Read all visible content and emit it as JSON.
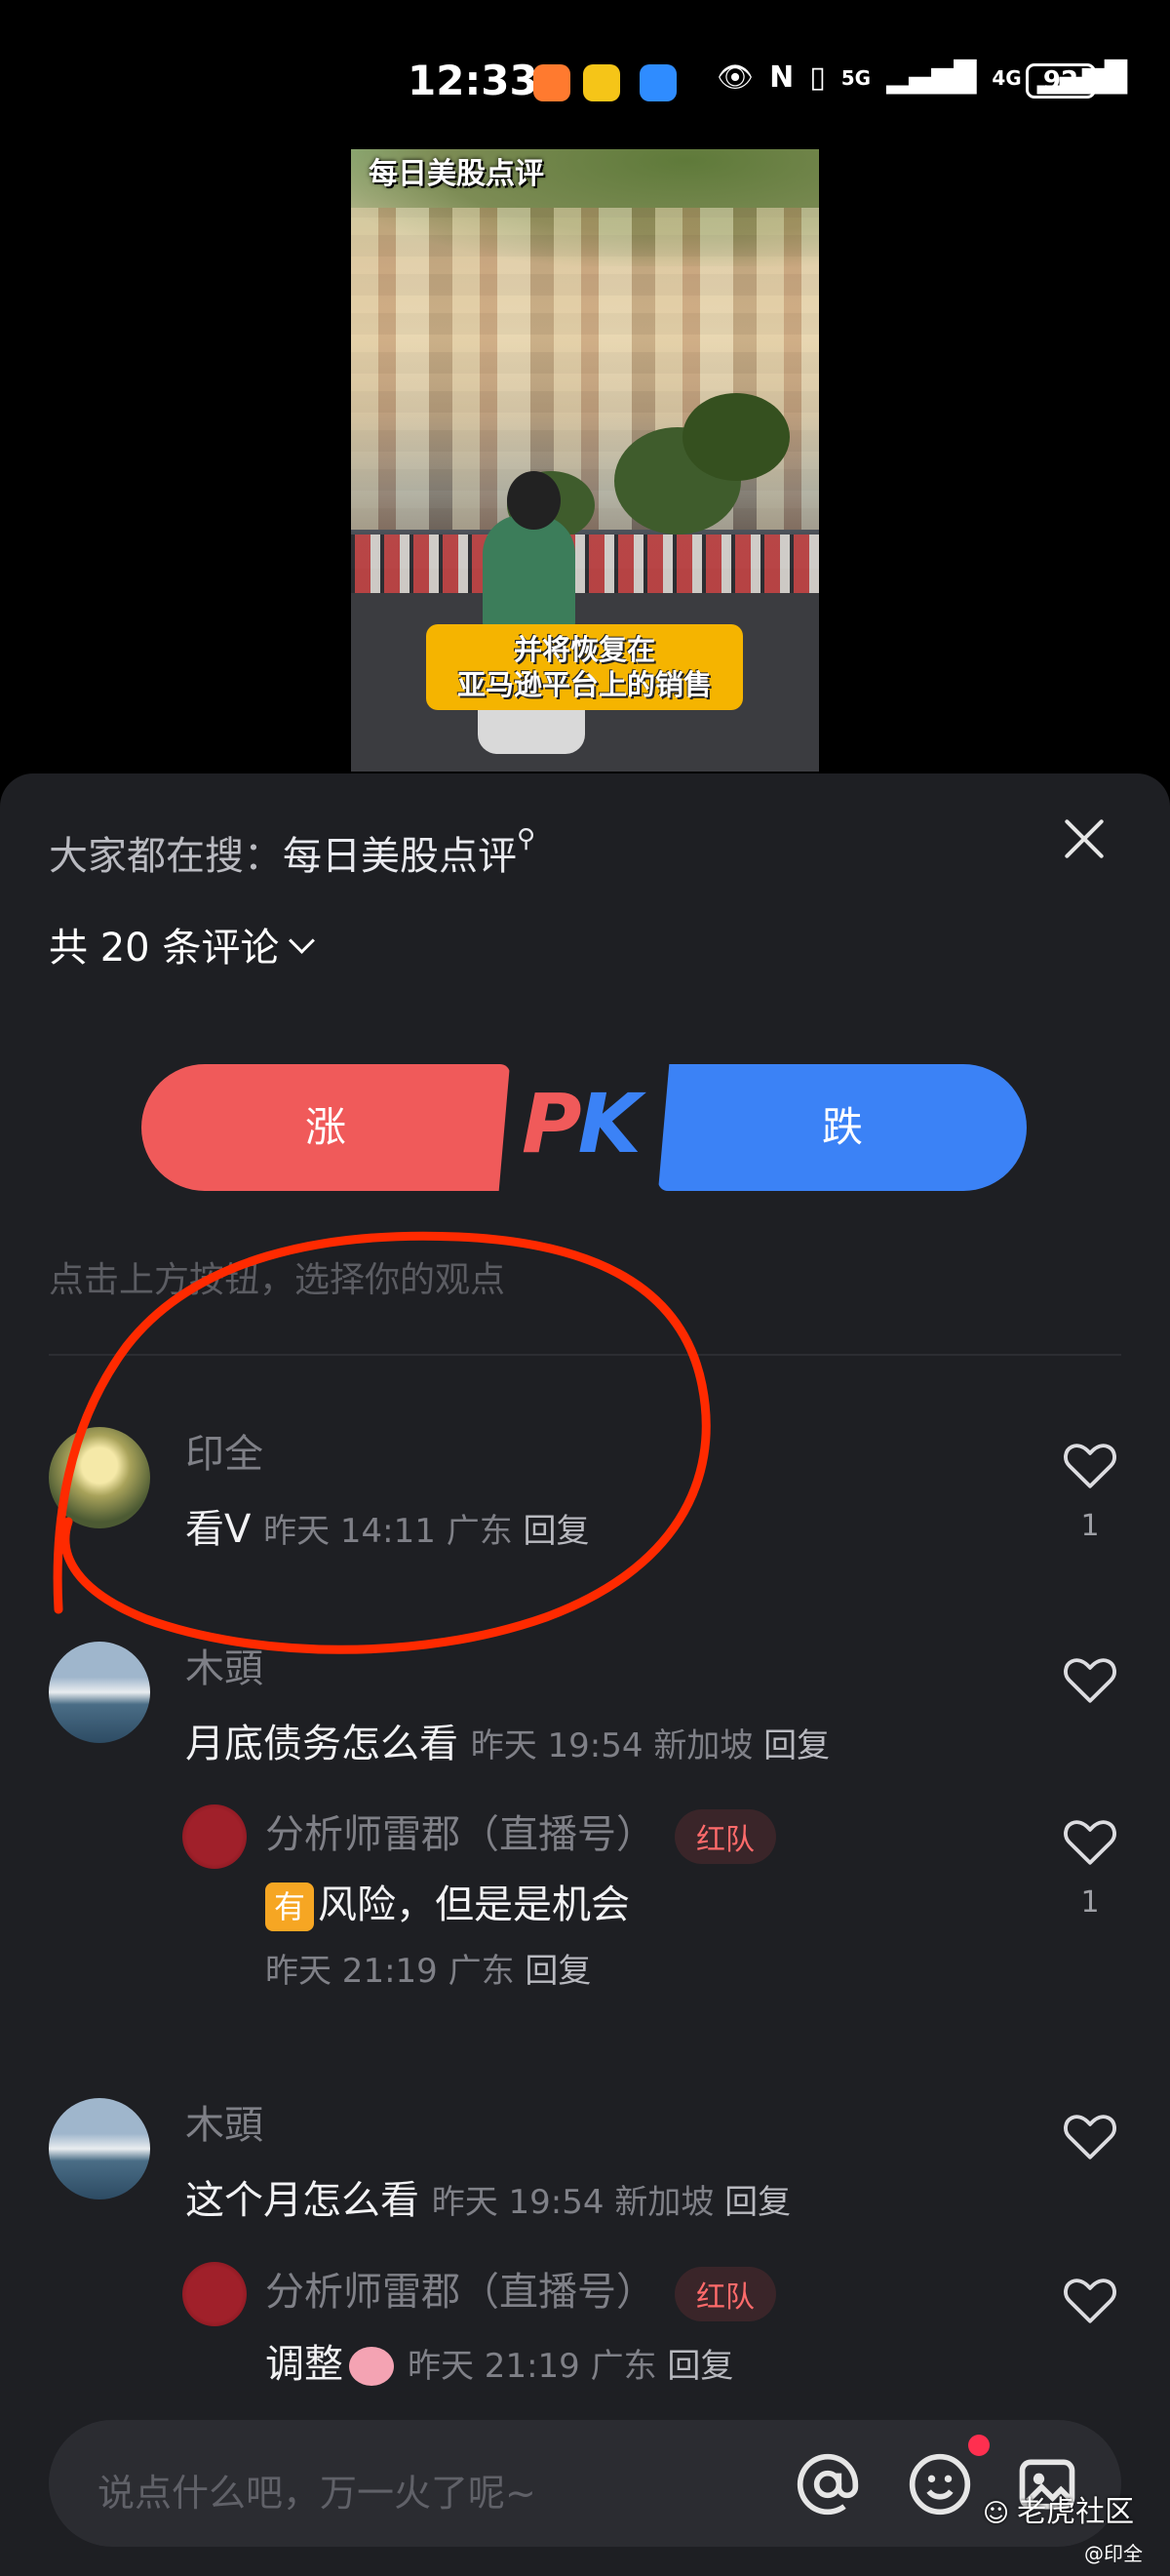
{
  "status_bar": {
    "time": "12:33",
    "battery": "92",
    "signal_labels": [
      "5G",
      "4G"
    ]
  },
  "video": {
    "title": "每日美股点评",
    "caption_line1": "并将恢复在",
    "caption_line2": "亚马逊平台上的销售"
  },
  "panel": {
    "search_prefix": "大家都在搜：",
    "search_keyword": "每日美股点评",
    "comment_count": "共 20 条评论",
    "pk": {
      "rise_label": "涨",
      "fall_label": "跌",
      "pk_p": "P",
      "pk_k": "K"
    },
    "hint": "点击上方按钮，选择你的观点"
  },
  "comments": [
    {
      "user": "印全",
      "text": "看V",
      "time": "昨天 14:11",
      "location": "广东",
      "reply": "回复",
      "likes": "1"
    },
    {
      "user": "木頭",
      "text": "月底债务怎么看",
      "time": "昨天 19:54",
      "location": "新加坡",
      "reply": "回复",
      "likes": "",
      "sub": {
        "user": "分析师雷郡（直播号）",
        "badge": "红队",
        "tag": "有",
        "text": "风险，但是是机会",
        "time": "昨天 21:19",
        "location": "广东",
        "reply": "回复",
        "likes": "1"
      }
    },
    {
      "user": "木頭",
      "text": "这个月怎么看",
      "time": "昨天 19:54",
      "location": "新加坡",
      "reply": "回复",
      "likes": "",
      "sub": {
        "user": "分析师雷郡（直播号）",
        "badge": "红队",
        "text": "调整",
        "time": "昨天 21:19",
        "location": "广东",
        "reply": "回复",
        "likes": ""
      }
    }
  ],
  "input": {
    "placeholder": "说点什么吧，万一火了呢~"
  },
  "watermark": {
    "brand": "老虎社区",
    "user": "@印全"
  },
  "colors": {
    "panel_bg": "#1e1f23",
    "rise": "#f05a5a",
    "fall": "#3b82f6",
    "annotation": "#ff2a00"
  }
}
